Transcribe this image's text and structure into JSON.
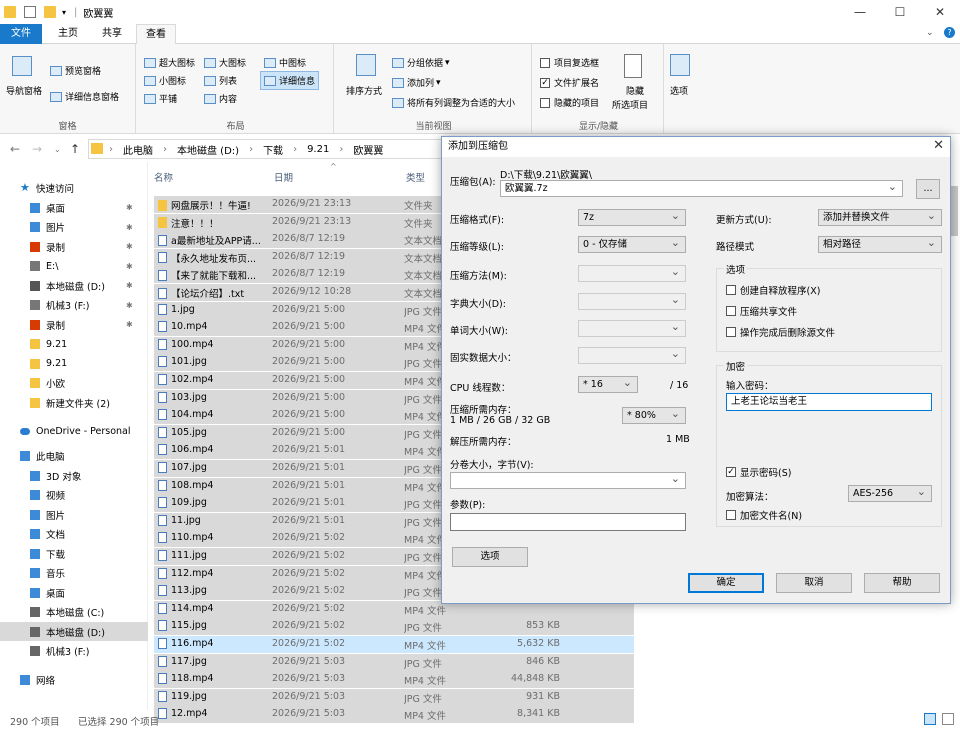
{
  "window": {
    "title": "欧翼翼"
  },
  "ribbon_tabs": {
    "file": "文件",
    "home": "主页",
    "share": "共享",
    "view": "查看"
  },
  "ribbon": {
    "nav_pane": "导航窗格",
    "preview_pane": "预览窗格",
    "details_pane": "详细信息窗格",
    "group_panes": "窗格",
    "layout_items": [
      "超大图标",
      "大图标",
      "中图标",
      "小图标",
      "列表",
      "详细信息",
      "平铺",
      "内容"
    ],
    "group_layout": "布局",
    "sort_by": "排序方式",
    "group_by": "分组依据",
    "add_columns": "添加列",
    "size_columns": "将所有列调整为合适的大小",
    "group_current_view": "当前视图",
    "item_checkboxes": "项目复选框",
    "file_extensions": "文件扩展名",
    "hidden_items": "隐藏的项目",
    "hide_selected_1": "隐藏",
    "hide_selected_2": "所选项目",
    "group_show_hide": "显示/隐藏",
    "options": "选项"
  },
  "address": {
    "parts": [
      "此电脑",
      "本地磁盘 (D:)",
      "下载",
      "9.21",
      "欧翼翼"
    ]
  },
  "nav": {
    "quick_access": "快速访问",
    "items": [
      "桌面",
      "图片",
      "录制",
      "E:\\",
      "本地磁盘 (D:)",
      "机械3 (F:)",
      "录制",
      "9.21",
      "9.21",
      "小欧",
      "新建文件夹 (2)"
    ],
    "onedrive": "OneDrive - Personal",
    "this_pc": "此电脑",
    "pc_items": [
      "3D 对象",
      "视频",
      "图片",
      "文档",
      "下载",
      "音乐",
      "桌面",
      "本地磁盘 (C:)",
      "本地磁盘 (D:)",
      "机械3 (F:)"
    ],
    "network": "网络"
  },
  "columns": {
    "name": "名称",
    "date": "日期",
    "type": "类型"
  },
  "files": [
    {
      "name": "网盘展示！！牛逼!",
      "date": "2026/9/21 23:13",
      "type": "文件夹",
      "size": "",
      "icon": "folder"
    },
    {
      "name": "注意！！！",
      "date": "2026/9/21 23:13",
      "type": "文件夹",
      "size": "",
      "icon": "folder"
    },
    {
      "name": "a最新地址及APP请...",
      "date": "2026/8/7 12:19",
      "type": "文本文档",
      "size": "",
      "icon": "file"
    },
    {
      "name": "【永久地址发布页...",
      "date": "2026/8/7 12:19",
      "type": "文本文档",
      "size": "",
      "icon": "file"
    },
    {
      "name": "【来了就能下载和...",
      "date": "2026/8/7 12:19",
      "type": "文本文档",
      "size": "",
      "icon": "file"
    },
    {
      "name": "【论坛介绍】.txt",
      "date": "2026/9/12 10:28",
      "type": "文本文档",
      "size": "",
      "icon": "file"
    },
    {
      "name": "1.jpg",
      "date": "2026/9/21 5:00",
      "type": "JPG 文件",
      "size": "",
      "icon": "file"
    },
    {
      "name": "10.mp4",
      "date": "2026/9/21 5:00",
      "type": "MP4 文件",
      "size": "",
      "icon": "file"
    },
    {
      "name": "100.mp4",
      "date": "2026/9/21 5:00",
      "type": "MP4 文件",
      "size": "",
      "icon": "file"
    },
    {
      "name": "101.jpg",
      "date": "2026/9/21 5:00",
      "type": "JPG 文件",
      "size": "",
      "icon": "file"
    },
    {
      "name": "102.mp4",
      "date": "2026/9/21 5:00",
      "type": "MP4 文件",
      "size": "",
      "icon": "file"
    },
    {
      "name": "103.jpg",
      "date": "2026/9/21 5:00",
      "type": "JPG 文件",
      "size": "",
      "icon": "file"
    },
    {
      "name": "104.mp4",
      "date": "2026/9/21 5:00",
      "type": "MP4 文件",
      "size": "",
      "icon": "file"
    },
    {
      "name": "105.jpg",
      "date": "2026/9/21 5:00",
      "type": "JPG 文件",
      "size": "",
      "icon": "file"
    },
    {
      "name": "106.mp4",
      "date": "2026/9/21 5:01",
      "type": "MP4 文件",
      "size": "",
      "icon": "file"
    },
    {
      "name": "107.jpg",
      "date": "2026/9/21 5:01",
      "type": "JPG 文件",
      "size": "",
      "icon": "file"
    },
    {
      "name": "108.mp4",
      "date": "2026/9/21 5:01",
      "type": "MP4 文件",
      "size": "",
      "icon": "file"
    },
    {
      "name": "109.jpg",
      "date": "2026/9/21 5:01",
      "type": "JPG 文件",
      "size": "",
      "icon": "file"
    },
    {
      "name": "11.jpg",
      "date": "2026/9/21 5:01",
      "type": "JPG 文件",
      "size": "",
      "icon": "file"
    },
    {
      "name": "110.mp4",
      "date": "2026/9/21 5:02",
      "type": "MP4 文件",
      "size": "",
      "icon": "file"
    },
    {
      "name": "111.jpg",
      "date": "2026/9/21 5:02",
      "type": "JPG 文件",
      "size": "",
      "icon": "file"
    },
    {
      "name": "112.mp4",
      "date": "2026/9/21 5:02",
      "type": "MP4 文件",
      "size": "",
      "icon": "file"
    },
    {
      "name": "113.jpg",
      "date": "2026/9/21 5:02",
      "type": "JPG 文件",
      "size": "",
      "icon": "file"
    },
    {
      "name": "114.mp4",
      "date": "2026/9/21 5:02",
      "type": "MP4 文件",
      "size": "",
      "icon": "file"
    },
    {
      "name": "115.jpg",
      "date": "2026/9/21 5:02",
      "type": "JPG 文件",
      "size": "853 KB",
      "icon": "file"
    },
    {
      "name": "116.mp4",
      "date": "2026/9/21 5:02",
      "type": "MP4 文件",
      "size": "5,632 KB",
      "icon": "file",
      "highlight": true
    },
    {
      "name": "117.jpg",
      "date": "2026/9/21 5:03",
      "type": "JPG 文件",
      "size": "846 KB",
      "icon": "file"
    },
    {
      "name": "118.mp4",
      "date": "2026/9/21 5:03",
      "type": "MP4 文件",
      "size": "44,848 KB",
      "icon": "file"
    },
    {
      "name": "119.jpg",
      "date": "2026/9/21 5:03",
      "type": "JPG 文件",
      "size": "931 KB",
      "icon": "file"
    },
    {
      "name": "12.mp4",
      "date": "2026/9/21 5:03",
      "type": "MP4 文件",
      "size": "8,341 KB",
      "icon": "file"
    }
  ],
  "status": {
    "count": "290 个项目",
    "selected": "已选择 290 个项目"
  },
  "dialog": {
    "title": "添加到压缩包",
    "archive_label": "压缩包(A):",
    "archive_path": "D:\\下载\\9.21\\欧翼翼\\",
    "archive_name": "欧翼翼.7z",
    "browse": "...",
    "format_label": "压缩格式(F):",
    "format_value": "7z",
    "level_label": "压缩等级(L):",
    "level_value": "0 - 仅存储",
    "method_label": "压缩方法(M):",
    "dict_label": "字典大小(D):",
    "word_label": "单词大小(W):",
    "solid_label": "固实数据大小：",
    "threads_label": "CPU 线程数：",
    "threads_value": "* 16",
    "threads_max": "/ 16",
    "mem_label": "压缩所需内存：",
    "mem_detail": "1 MB / 26 GB / 32 GB",
    "mem_value": "* 80%",
    "decomp_label": "解压所需内存：",
    "decomp_value": "1 MB",
    "split_label": "分卷大小，字节(V):",
    "params_label": "参数(P):",
    "options_btn": "选项",
    "update_label": "更新方式(U):",
    "update_value": "添加并替换文件",
    "path_label": "路径模式",
    "path_value": "相对路径",
    "options_group": "选项",
    "opt_sfx": "创建自释放程序(X)",
    "opt_shared": "压缩共享文件",
    "opt_delete": "操作完成后删除源文件",
    "encrypt_group": "加密",
    "pwd_label": "输入密码：",
    "pwd_value": "上老王论坛当老王",
    "show_pwd": "显示密码(S)",
    "enc_method_label": "加密算法：",
    "enc_method_value": "AES-256",
    "enc_names": "加密文件名(N)",
    "ok": "确定",
    "cancel": "取消",
    "help": "帮助"
  }
}
